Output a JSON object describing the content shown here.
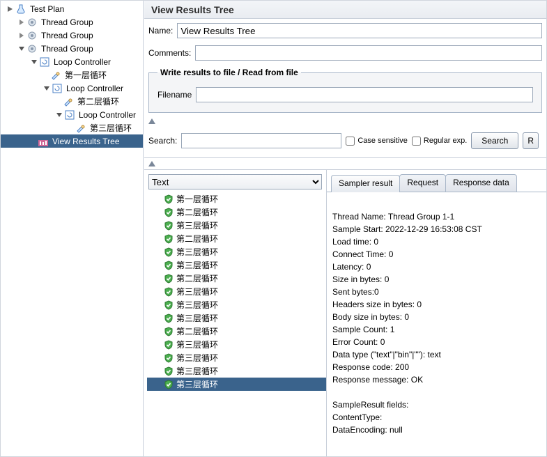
{
  "tree": {
    "testPlan": "Test Plan",
    "threadGroup1": "Thread Group",
    "threadGroup2": "Thread Group",
    "threadGroup3": "Thread Group",
    "loop1": "Loop Controller",
    "loop1sampler": "第一层循环",
    "loop2": "Loop Controller",
    "loop2sampler": "第二层循环",
    "loop3": "Loop Controller",
    "loop3sampler": "第三层循环",
    "viewResults": "View Results Tree"
  },
  "title": "View Results Tree",
  "labels": {
    "name": "Name:",
    "comments": "Comments:",
    "writeLegend": "Write results to file / Read from file",
    "filename": "Filename",
    "search": "Search:"
  },
  "fields": {
    "nameValue": "View Results Tree",
    "commentsValue": "",
    "filenameValue": "",
    "searchValue": "",
    "caseSensitive": "Case sensitive",
    "regularExp": "Regular exp.",
    "searchButton": "Search",
    "resetButton": "R"
  },
  "viewMode": "Text",
  "results": [
    "第一层循环",
    "第二层循环",
    "第三层循环",
    "第二层循环",
    "第三层循环",
    "第三层循环",
    "第二层循环",
    "第三层循环",
    "第三层循环",
    "第三层循环",
    "第二层循环",
    "第三层循环",
    "第三层循环",
    "第三层循环",
    "第三层循环"
  ],
  "resultsSelectedIndex": 14,
  "tabs": {
    "sampler": "Sampler result",
    "request": "Request",
    "responseData": "Response data",
    "activeIndex": 0
  },
  "samplerResult": {
    "threadName": "Thread Name: Thread Group 1-1",
    "sampleStart": "Sample Start: 2022-12-29 16:53:08 CST",
    "loadTime": "Load time: 0",
    "connectTime": "Connect Time: 0",
    "latency": "Latency: 0",
    "sizeInBytes": "Size in bytes: 0",
    "sentBytes": "Sent bytes:0",
    "headersSize": "Headers size in bytes: 0",
    "bodySize": "Body size in bytes: 0",
    "sampleCount": "Sample Count: 1",
    "errorCount": "Error Count: 0",
    "dataType": "Data type (\"text\"|\"bin\"|\"\"): text",
    "responseCode": "Response code: 200",
    "responseMessage": "Response message: OK",
    "blank": " ",
    "sampleResultFields": "SampleResult fields:",
    "contentType": "ContentType:",
    "dataEncoding": "DataEncoding: null"
  }
}
